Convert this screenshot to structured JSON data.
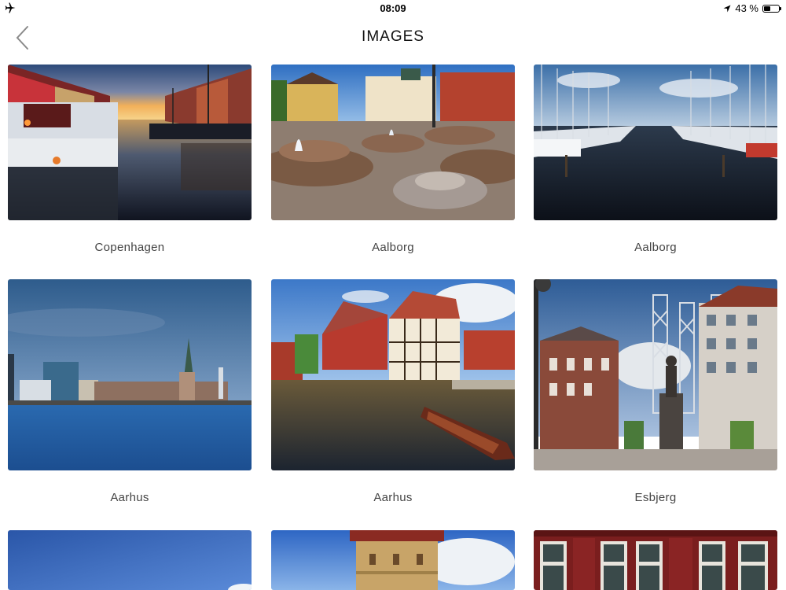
{
  "status_bar": {
    "time": "08:09",
    "battery": "43 %",
    "battery_level": 0.43
  },
  "nav": {
    "title": "IMAGES"
  },
  "images": [
    {
      "caption": "Copenhagen"
    },
    {
      "caption": "Aalborg"
    },
    {
      "caption": "Aalborg"
    },
    {
      "caption": "Aarhus"
    },
    {
      "caption": "Aarhus"
    },
    {
      "caption": "Esbjerg"
    },
    {
      "caption": ""
    },
    {
      "caption": ""
    },
    {
      "caption": ""
    }
  ]
}
